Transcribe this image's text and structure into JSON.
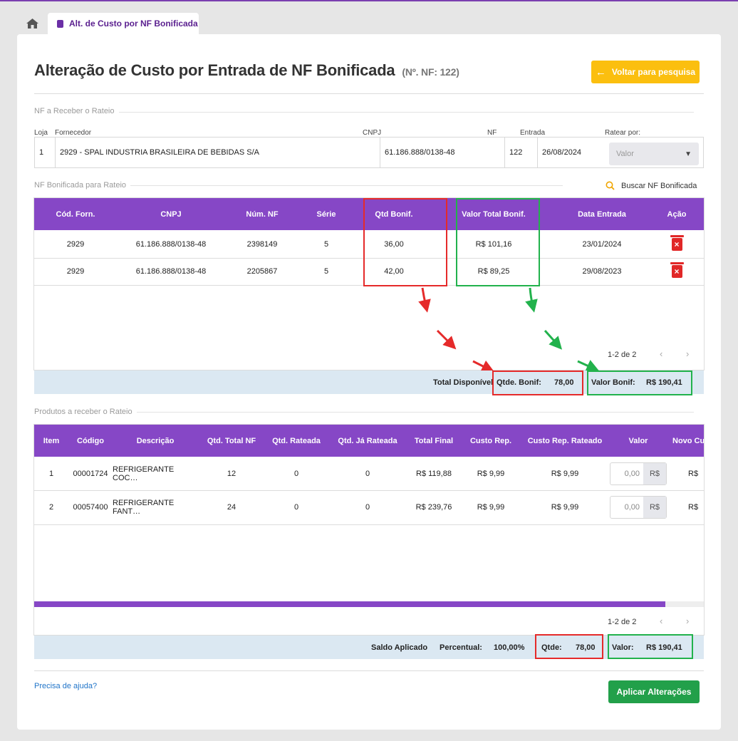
{
  "tabs": {
    "active_label": "Alt. de Custo por NF Bonificada"
  },
  "header": {
    "title": "Alteração de Custo por Entrada de NF Bonificada",
    "subtitle": "(Nº. NF: 122)",
    "back_button": "Voltar para pesquisa",
    "back_icon": "arrow-left-icon"
  },
  "nf_receber": {
    "legend": "NF a Receber o Rateio",
    "labels": {
      "loja": "Loja",
      "fornecedor": "Fornecedor",
      "cnpj": "CNPJ",
      "nf": "NF",
      "entrada": "Entrada",
      "ratear_por": "Ratear por:"
    },
    "values": {
      "loja": "1",
      "fornecedor": "2929 - SPAL INDUSTRIA BRASILEIRA DE BEBIDAS S/A",
      "cnpj": "61.186.888/0138-48",
      "nf": "122",
      "entrada": "26/08/2024"
    },
    "ratear_placeholder": "Valor"
  },
  "nf_bonificada": {
    "legend": "NF Bonificada para Rateio",
    "search_label": "Buscar NF Bonificada",
    "columns": [
      "Cód. Forn.",
      "CNPJ",
      "Núm. NF",
      "Série",
      "Qtd Bonif.",
      "Valor Total Bonif.",
      "Data Entrada",
      "Ação"
    ],
    "rows": [
      [
        "2929",
        "61.186.888/0138-48",
        "2398149",
        "5",
        "36,00",
        "R$ 101,16",
        "23/01/2024"
      ],
      [
        "2929",
        "61.186.888/0138-48",
        "2205867",
        "5",
        "42,00",
        "R$ 89,25",
        "29/08/2023"
      ]
    ],
    "pagination": "1-2 de 2",
    "totals": {
      "label": "Total Disponível",
      "qtde_label": "Qtde. Bonif:",
      "qtde_value": "78,00",
      "valor_label": "Valor Bonif:",
      "valor_value": "R$ 190,41"
    }
  },
  "produtos": {
    "legend": "Produtos a receber o Rateio",
    "columns": [
      "Item",
      "Código",
      "Descrição",
      "Qtd. Total NF",
      "Qtd. Rateada",
      "Qtd. Já Rateada",
      "Total Final",
      "Custo Rep.",
      "Custo Rep. Rateado",
      "Valor",
      "Novo Cu"
    ],
    "rows": [
      [
        "1",
        "00001724",
        "REFRIGERANTE COC…",
        "12",
        "0",
        "0",
        "R$ 119,88",
        "R$ 9,99",
        "R$ 9,99",
        "0,00",
        "R$"
      ],
      [
        "2",
        "00057400",
        "REFRIGERANTE FANT…",
        "24",
        "0",
        "0",
        "R$ 239,76",
        "R$ 9,99",
        "R$ 9,99",
        "0,00",
        "R$"
      ]
    ],
    "input_suffix": "R$",
    "pagination": "1-2 de 2",
    "totals": {
      "saldo_label": "Saldo Aplicado",
      "percentual_label": "Percentual:",
      "percentual_value": "100,00%",
      "qtde_label": "Qtde:",
      "qtde_value": "78,00",
      "valor_label": "Valor:",
      "valor_value": "R$ 190,41"
    }
  },
  "footer": {
    "help_link": "Precisa de ajuda?",
    "apply_button": "Aplicar Alterações"
  },
  "colors": {
    "purple": "#8647c6",
    "yellow": "#fbbf0f",
    "green": "#22a04a",
    "red_annot": "#e52a2a",
    "green_annot": "#22b24c",
    "totals_bg": "#dbe8f2"
  }
}
